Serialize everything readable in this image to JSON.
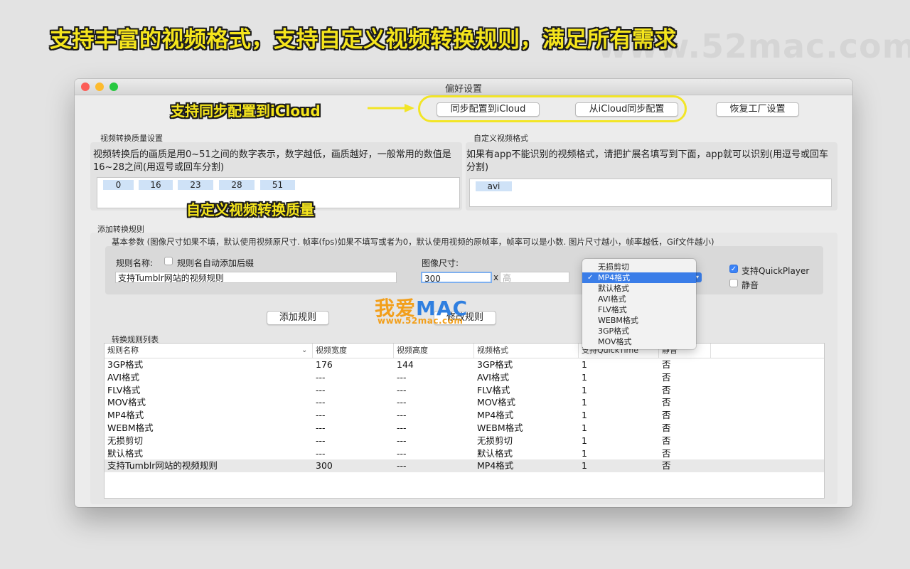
{
  "banner": {
    "text": "支持丰富的视频格式，支持自定义视频转换规则，满足所有需求"
  },
  "watermark_top": {
    "text": "www.52mac.com"
  },
  "window": {
    "title": "偏好设置"
  },
  "sync": {
    "callout": "支持同步配置到iCloud",
    "push_label": "同步配置到iCloud",
    "pull_label": "从iCloud同步配置",
    "reset_label": "恢复工厂设置"
  },
  "quality": {
    "section_label": "视频转换质量设置",
    "description": "视频转换后的画质是用0~51之间的数字表示，数字越低，画质越好，一般常用的数值是16~28之间(用逗号或回车分割)",
    "tokens": [
      "0",
      "16",
      "23",
      "28",
      "51"
    ],
    "callout": "自定义视频转换质量"
  },
  "custom_formats": {
    "section_label": "自定义视频格式",
    "description": "如果有app不能识别的视频格式，请把扩展名填写到下面，app就可以识别(用逗号或回车分割)",
    "tokens": [
      "avi"
    ]
  },
  "add_rule": {
    "section_label": "添加转换规则",
    "params_note": "基本参数 (图像尺寸如果不填，默认使用视频原尺寸. 帧率(fps)如果不填写或者为0，默认使用视频的原帧率，帧率可以是小数. 图片尺寸越小，帧率越低，Gif文件越小)",
    "rule_name_label": "规则名称:",
    "auto_suffix_label": "规则名自动添加后缀",
    "rule_name_value": "支持Tumblr网站的视频规则",
    "image_size_label": "图像尺寸:",
    "width_value": "300",
    "times": "x",
    "height_placeholder": "高",
    "quickplayer_label": "支持QuickPlayer",
    "mute_label": "静音",
    "add_button": "添加规则",
    "modify_button": "修改规则"
  },
  "format_menu": {
    "items": [
      "无损剪切",
      "MP4格式",
      "默认格式",
      "AVI格式",
      "FLV格式",
      "WEBM格式",
      "3GP格式",
      "MOV格式"
    ],
    "selected": "MP4格式",
    "check": "✓"
  },
  "watermark": {
    "logo_a": "我爱",
    "logo_b": "MAC",
    "url": "www.52mac.com"
  },
  "rules_list": {
    "section_label": "转换规则列表",
    "columns": [
      "规则名称",
      "视频宽度",
      "视频高度",
      "视频格式",
      "支持QuickTime",
      "静音"
    ],
    "rows": [
      [
        "3GP格式",
        "176",
        "144",
        "3GP格式",
        "1",
        "否"
      ],
      [
        "AVI格式",
        "---",
        "---",
        "AVI格式",
        "1",
        "否"
      ],
      [
        "FLV格式",
        "---",
        "---",
        "FLV格式",
        "1",
        "否"
      ],
      [
        "MOV格式",
        "---",
        "---",
        "MOV格式",
        "1",
        "否"
      ],
      [
        "MP4格式",
        "---",
        "---",
        "MP4格式",
        "1",
        "否"
      ],
      [
        "WEBM格式",
        "---",
        "---",
        "WEBM格式",
        "1",
        "否"
      ],
      [
        "无损剪切",
        "---",
        "---",
        "无损剪切",
        "1",
        "否"
      ],
      [
        "默认格式",
        "---",
        "---",
        "默认格式",
        "1",
        "否"
      ],
      [
        "支持Tumblr网站的视频规则",
        "300",
        "---",
        "MP4格式",
        "1",
        "否"
      ]
    ],
    "selected_row": 8
  },
  "colors": {
    "banner": "#f5e51c",
    "highlight_ring": "#f2e526",
    "accent": "#3a7de8",
    "watermark_blue": "#2f7fe0",
    "watermark_orange": "#f29f1b"
  },
  "icons": {
    "sort": "chevron-down-icon",
    "arrow": "arrow-right-icon"
  }
}
